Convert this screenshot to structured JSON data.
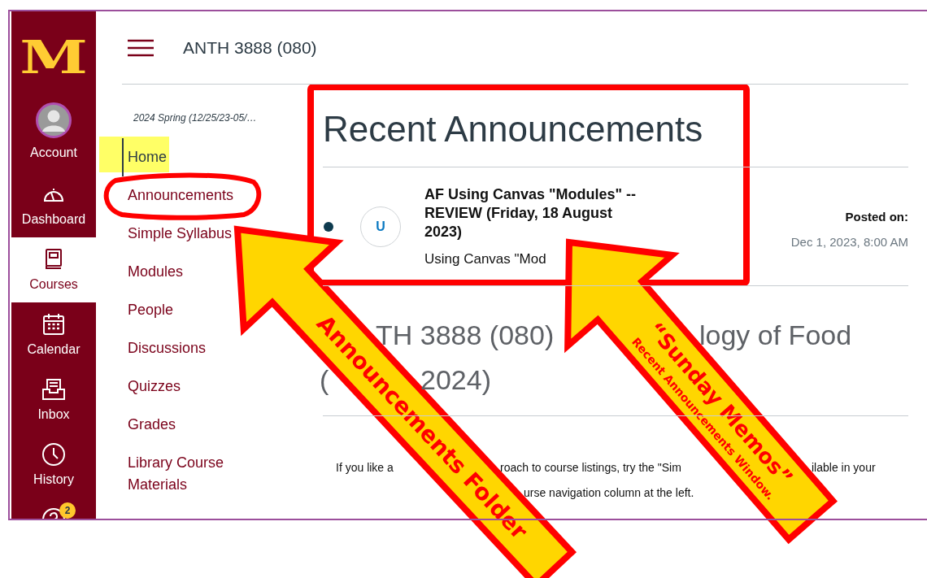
{
  "global_nav": {
    "logo": "M",
    "items": [
      {
        "kind": "account",
        "label": "Account",
        "selected": false
      },
      {
        "kind": "dashboard",
        "label": "Dashboard",
        "selected": false
      },
      {
        "kind": "courses",
        "label": "Courses",
        "selected": true
      },
      {
        "kind": "calendar",
        "label": "Calendar",
        "selected": false
      },
      {
        "kind": "inbox",
        "label": "Inbox",
        "selected": false
      },
      {
        "kind": "history",
        "label": "History",
        "selected": false
      },
      {
        "kind": "help",
        "badge": "2",
        "selected": false
      }
    ]
  },
  "header": {
    "title": "ANTH 3888 (080)"
  },
  "course_nav": {
    "term": "2024 Spring (12/25/23-05/…",
    "items": [
      {
        "label": "Home",
        "selected": true
      },
      {
        "label": "Announcements",
        "selected": false
      },
      {
        "label": "Simple Syllabus",
        "selected": false
      },
      {
        "label": "Modules",
        "selected": false
      },
      {
        "label": "People",
        "selected": false
      },
      {
        "label": "Discussions",
        "selected": false
      },
      {
        "label": "Quizzes",
        "selected": false
      },
      {
        "label": "Grades",
        "selected": false
      },
      {
        "label": "Library Course Materials",
        "selected": false
      }
    ]
  },
  "recent_announcements": {
    "title": "Recent Announcements",
    "items": [
      {
        "unread": true,
        "avatar": "U",
        "title": "AF Using Canvas \"Modules\" -- REVIEW (Friday, 18 August 2023)",
        "excerpt": "Using Canvas \"Mod",
        "posted_label": "Posted on:",
        "posted": "Dec 1, 2023, 8:00 AM"
      }
    ]
  },
  "course_heading": {
    "line_1": [
      "TH 3888 (080)",
      "logy of Food"
    ],
    "line_2": [
      "(",
      "2024)"
    ]
  },
  "intro": {
    "line_1": [
      "If you like a",
      "roach to course listings, try the \"Sim",
      "ilable in your"
    ],
    "line_2": [
      "urse navigation column at the left."
    ]
  },
  "annotations": [
    {
      "kind": "highlight"
    },
    {
      "kind": "ellipse"
    },
    {
      "kind": "frame"
    },
    {
      "kind": "arrow",
      "lines": [
        "Announcements Folder"
      ]
    },
    {
      "kind": "arrow",
      "lines": [
        "“Sunday Memos”",
        "Recent Announcements Window."
      ]
    }
  ]
}
